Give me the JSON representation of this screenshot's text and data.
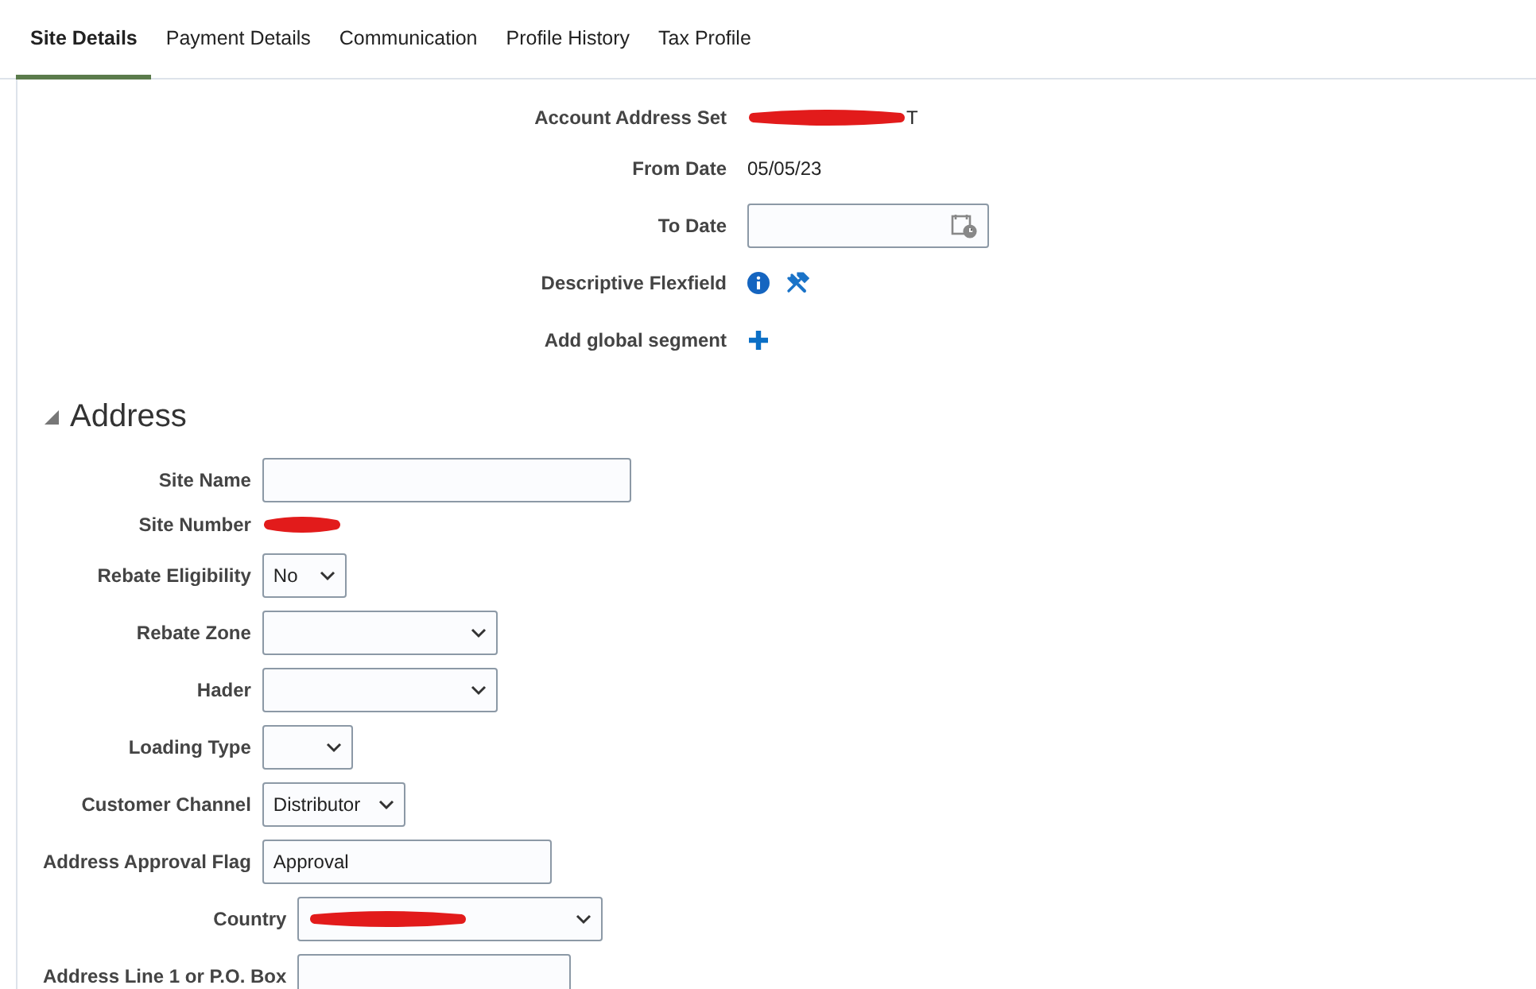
{
  "tabs": [
    {
      "label": "Site Details",
      "selected": true
    },
    {
      "label": "Payment Details",
      "selected": false
    },
    {
      "label": "Communication",
      "selected": false
    },
    {
      "label": "Profile History",
      "selected": false
    },
    {
      "label": "Tax Profile",
      "selected": false
    }
  ],
  "header_fields": [
    {
      "kind": "redacted",
      "label": "Account Address Set",
      "value": "T"
    },
    {
      "kind": "text",
      "label": "From Date",
      "value": "05/05/23"
    },
    {
      "kind": "date",
      "label": "To Date"
    },
    {
      "kind": "flexfield",
      "label": "Descriptive Flexfield"
    },
    {
      "kind": "add",
      "label": "Add global segment"
    }
  ],
  "address": {
    "title": "Address",
    "expanded": true,
    "groups": [
      [
        {
          "kind": "input",
          "label": "Site Name"
        },
        {
          "kind": "redacted",
          "label": "Site Number"
        },
        {
          "kind": "select",
          "label": "Rebate Eligibility",
          "value": "No"
        },
        {
          "kind": "select",
          "label": "Rebate Zone"
        },
        {
          "kind": "select",
          "label": "Hader"
        },
        {
          "kind": "select",
          "label": "Loading Type"
        },
        {
          "kind": "select",
          "label": "Customer Channel",
          "value": "Distributor"
        },
        {
          "kind": "input",
          "label": "Address Approval Flag",
          "value": "Approval"
        }
      ],
      [
        {
          "kind": "select",
          "label": "Country",
          "redacted": true
        },
        {
          "kind": "input",
          "label": "Address Line 1 or P.O. Box"
        }
      ]
    ]
  }
}
